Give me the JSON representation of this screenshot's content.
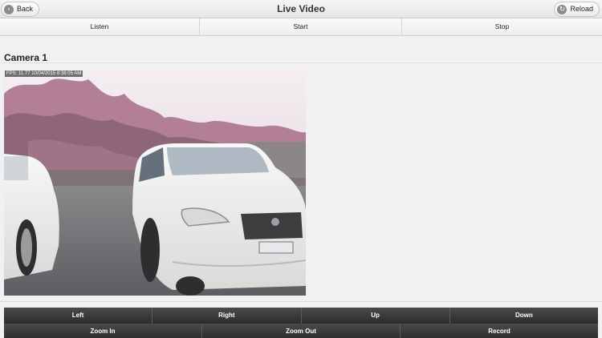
{
  "header": {
    "title": "Live Video",
    "back_label": "Back",
    "reload_label": "Reload"
  },
  "navbar": [
    "Listen",
    "Start",
    "Stop"
  ],
  "camera": {
    "title": "Camera 1",
    "overlay": "FPS: 11.77 10/04/2015 8:38:05 AM"
  },
  "controls": {
    "row1": [
      "Left",
      "Right",
      "Up",
      "Down"
    ],
    "row2": [
      "Zoom In",
      "Zoom Out",
      "Record"
    ]
  },
  "icons": {
    "back": "back-arrow-icon",
    "reload": "reload-icon"
  }
}
